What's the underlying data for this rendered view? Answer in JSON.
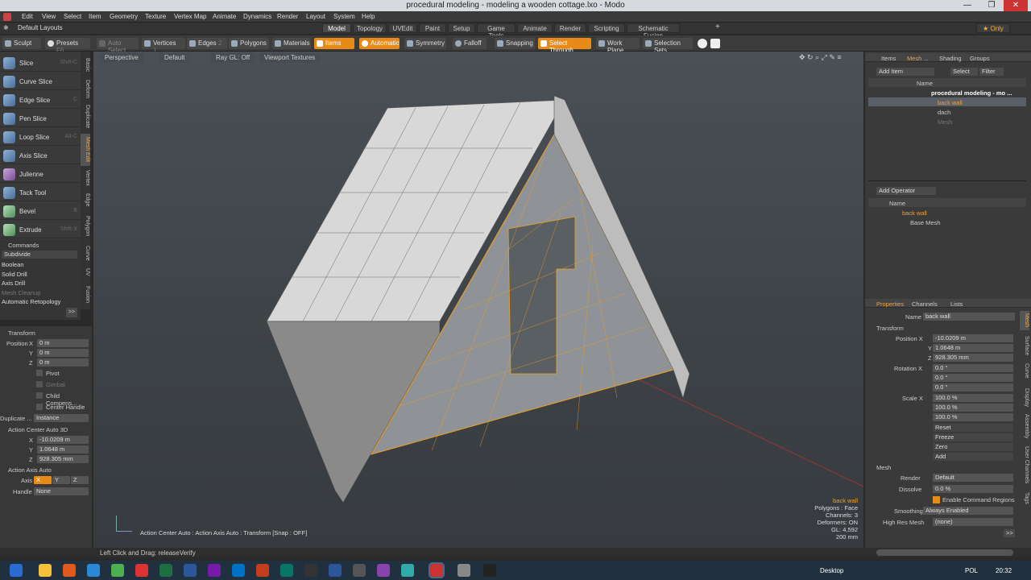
{
  "window": {
    "title": "procedural modeling - modeling a wooden cottage.lxo - Modo",
    "minimize": "—",
    "maximize": "❐",
    "close": "✕"
  },
  "menu": [
    "Edit",
    "View",
    "Select",
    "Item",
    "Geometry",
    "Texture",
    "Vertex Map",
    "Animate",
    "Dynamics",
    "Render",
    "Layout",
    "System",
    "Help"
  ],
  "layout": {
    "name": "Default Layouts",
    "tabs": [
      "Model",
      "Topology",
      "UVEdit",
      "Paint",
      "Setup",
      "Game Tools",
      "Animate",
      "Render",
      "Scripting",
      "Schematic Fusion"
    ],
    "active": "Model",
    "only": "Only",
    "add": "+"
  },
  "toolbar": {
    "sculpt": "Sculpt",
    "presets": "Presets",
    "presets_key": "F6",
    "auto_select": "Auto Select",
    "vertices": "Vertices",
    "vertices_key": "1",
    "edges": "Edges",
    "edges_key": "2",
    "polygons": "Polygons",
    "materials": "Materials",
    "items": "Items",
    "automatic": "Automatic",
    "symmetry": "Symmetry",
    "falloff": "Falloff",
    "snapping": "Snapping",
    "select_through": "Select Through",
    "work_plane": "Work Plane",
    "selection_sets": "Selection Sets"
  },
  "tools": [
    {
      "label": "Slice",
      "key": "Shift-C"
    },
    {
      "label": "Curve Slice",
      "key": ""
    },
    {
      "label": "Edge Slice",
      "key": "C"
    },
    {
      "label": "Pen Slice",
      "key": ""
    },
    {
      "label": "Loop Slice",
      "key": "Alt-C"
    },
    {
      "label": "Axis Slice",
      "key": ""
    },
    {
      "label": "Julienne",
      "key": ""
    },
    {
      "label": "Tack Tool",
      "key": ""
    },
    {
      "label": "Bevel",
      "key": "B"
    },
    {
      "label": "Extrude",
      "key": "Shift-X"
    }
  ],
  "vtabs": [
    "Basic",
    "Deform",
    "Duplicate",
    "Mesh Edit",
    "Vertex",
    "Edge",
    "Polygon",
    "Curve",
    "UV",
    "Fusion"
  ],
  "commands": {
    "header": "Commands",
    "subdivide": "Subdivide",
    "items": [
      "Boolean",
      "Solid Drill",
      "Axis Drill",
      "Mesh Cleanup",
      "Automatic Retopology"
    ],
    "more": ">>"
  },
  "transform": {
    "header": "Transform",
    "position": "Position",
    "x": "X",
    "y": "Y",
    "z": "Z",
    "px": "0 m",
    "py": "0 m",
    "pz": "0 m",
    "pivot": "Pivot",
    "gimbal": "Gimbal",
    "child": "Child Compens...",
    "center": "Center Handle",
    "duplicate": "Duplicate ...",
    "instance": "Instance"
  },
  "action_center": {
    "header": "Action Center Auto 3D",
    "x": "X",
    "y": "Y",
    "z": "Z",
    "vx": "-10.0209 m",
    "vy": "1.0648 m",
    "vz": "928.305 mm"
  },
  "action_axis": {
    "header": "Action Axis Auto",
    "axis": "Axis",
    "ax": "X",
    "ay": "Y",
    "az": "Z",
    "handle": "Handle",
    "none": "None"
  },
  "viewport": {
    "perspective": "Perspective",
    "default": "Default",
    "raygl": "Ray GL: Off",
    "textures": "Viewport Textures",
    "info_name": "back wall",
    "info_polys": "Polygons : Face",
    "info_channels": "Channels: 3",
    "info_deform": "Deformers: ON",
    "info_gl": "GL: 4,592",
    "info_mm": "200 mm",
    "hint": "Action Center Auto : Action Axis Auto : Transform [Snap : OFF]"
  },
  "items_panel": {
    "tabs": [
      "Items",
      "Mesh ...",
      "Shading",
      "Groups"
    ],
    "add_item": "Add Item",
    "select": "Select",
    "filter": "Filter",
    "name": "Name",
    "rows": [
      "procedural modeling - mo ...",
      "back wall",
      "dach",
      "Mesh"
    ]
  },
  "operators": {
    "add": "Add Operator",
    "name": "Name",
    "rows": [
      "back wall",
      "Base Mesh"
    ]
  },
  "properties": {
    "tabs": [
      "Properties",
      "Channels",
      "Lists"
    ],
    "name_label": "Name",
    "name": "back wall",
    "transform": "Transform",
    "position": "Position X",
    "px": "-10.0209 m",
    "py": "1.0648 m",
    "pz": "928.305 mm",
    "rotation": "Rotation X",
    "rx": "0.0 °",
    "ry": "0.0 °",
    "rz": "0.0 °",
    "scale": "Scale X",
    "sx": "100.0 %",
    "sy": "100.0 %",
    "sz": "100.0 %",
    "y": "Y",
    "z": "Z",
    "reset": "Reset",
    "freeze": "Freeze",
    "zero": "Zero",
    "add": "Add",
    "mesh": "Mesh",
    "render": "Render",
    "render_v": "Default",
    "dissolve": "Dissolve",
    "dissolve_v": "0.0 %",
    "ecr": "Enable Command Regions",
    "smoothing": "Smoothing",
    "smoothing_v": "Always Enabled",
    "hires": "High Res Mesh",
    "hires_v": "(none)",
    "more": ">>",
    "side_tabs": [
      "Mesh",
      "Surface",
      "Curve",
      "Display",
      "Assembly",
      "User Channels",
      "Tags"
    ]
  },
  "status": {
    "text": "Left Click and Drag:  releaseVerify"
  },
  "taskbar": {
    "desktop": "Desktop",
    "lang": "POL",
    "time": "20:32"
  }
}
